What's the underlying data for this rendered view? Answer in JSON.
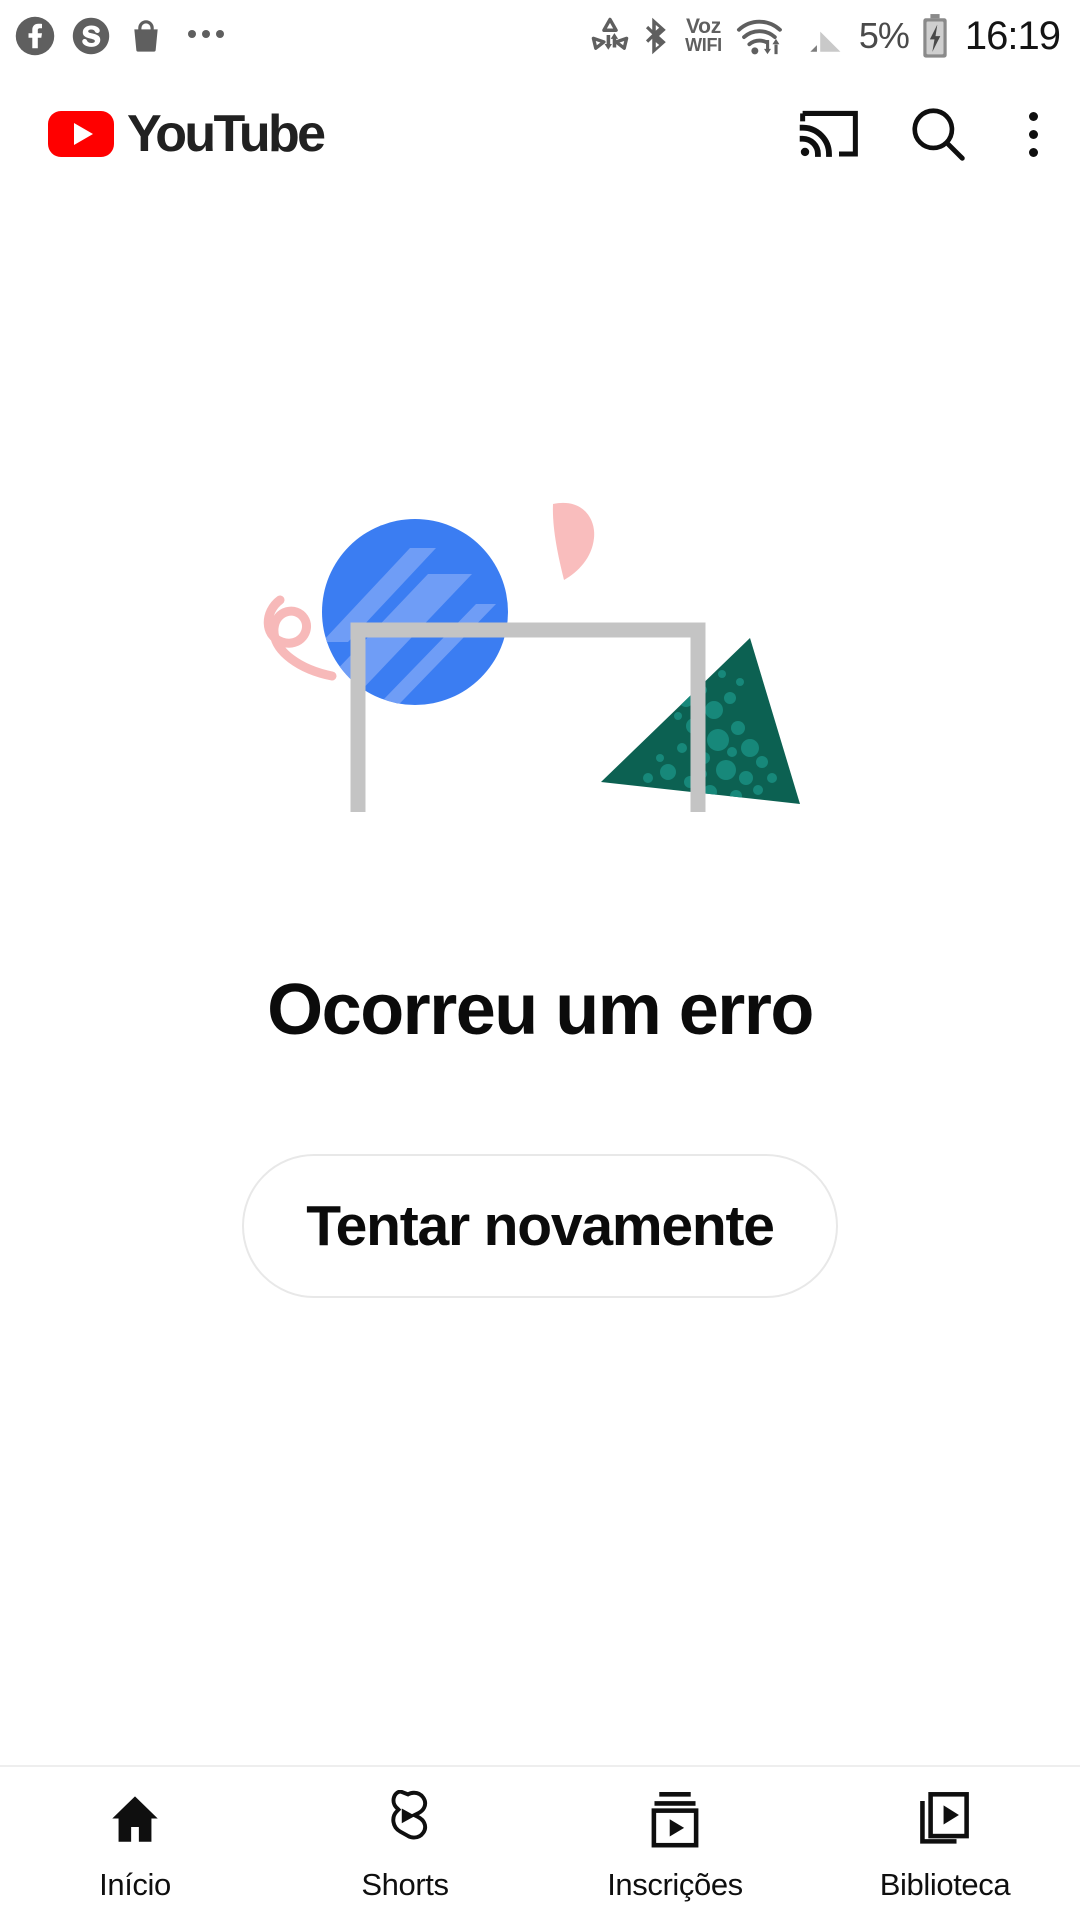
{
  "status_bar": {
    "left_icons": [
      {
        "name": "facebook-icon",
        "glyph": "f"
      },
      {
        "name": "skype-icon",
        "glyph": "S"
      },
      {
        "name": "shopping-bag-icon",
        "glyph": "bag"
      },
      {
        "name": "more-notifications-icon",
        "glyph": "..."
      }
    ],
    "data_transfer_icon": "data-saver-icon",
    "bluetooth_icon": "bluetooth-icon",
    "voz_line1": "Voz",
    "voz_line2": "WIFI",
    "wifi_icon": "wifi-with-activity-icon",
    "cell_signal_icon": "cell-signal-icon",
    "battery_percent": "5%",
    "battery_icon": "battery-charging-icon",
    "time": "16:19"
  },
  "header": {
    "logo_word": "YouTube",
    "logo_accent_color": "#FF0000",
    "actions": [
      {
        "name": "cast-button",
        "label": "Cast"
      },
      {
        "name": "search-button",
        "label": "Search"
      },
      {
        "name": "more-options-button",
        "label": "More options"
      }
    ]
  },
  "error": {
    "title": "Ocorreu um erro",
    "retry_label": "Tentar novamente",
    "illustration": {
      "circle_color": "#3b7df2",
      "circle_stripe_color": "#6f9df6",
      "frame_color": "#c4c4c4",
      "petal_color": "#f9bdbd",
      "squiggle_color": "#f7b9b9",
      "triangle_color": "#0c6152",
      "triangle_speckle_color": "#17887a"
    }
  },
  "bottom_nav": {
    "items": [
      {
        "label": "Início",
        "icon": "home-icon",
        "selected": true
      },
      {
        "label": "Shorts",
        "icon": "shorts-icon",
        "selected": false
      },
      {
        "label": "Inscrições",
        "icon": "subscriptions-icon",
        "selected": false
      },
      {
        "label": "Biblioteca",
        "icon": "library-icon",
        "selected": false
      }
    ]
  }
}
